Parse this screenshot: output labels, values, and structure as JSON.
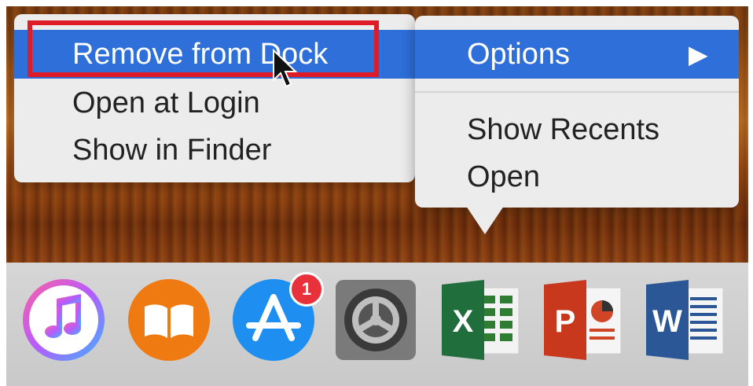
{
  "context_menu": {
    "items": [
      {
        "label": "Remove from Dock",
        "highlighted": true
      },
      {
        "label": "Open at Login"
      },
      {
        "label": "Show in Finder"
      }
    ]
  },
  "app_menu": {
    "items": [
      {
        "label": "Options",
        "submenu_arrow": "▶",
        "highlighted": true
      },
      {
        "label": "Show Recents"
      },
      {
        "label": "Open"
      }
    ]
  },
  "dock": {
    "icons": [
      {
        "name": "itunes-icon"
      },
      {
        "name": "ibooks-icon"
      },
      {
        "name": "app-store-icon",
        "badge": "1"
      },
      {
        "name": "system-preferences-icon"
      },
      {
        "name": "excel-icon",
        "letter": "X"
      },
      {
        "name": "powerpoint-icon",
        "letter": "P"
      },
      {
        "name": "word-icon",
        "letter": "W"
      }
    ]
  },
  "colors": {
    "highlight": "#2e6fd9",
    "focus_outline": "#e01b28",
    "badge": "#e8313b"
  }
}
